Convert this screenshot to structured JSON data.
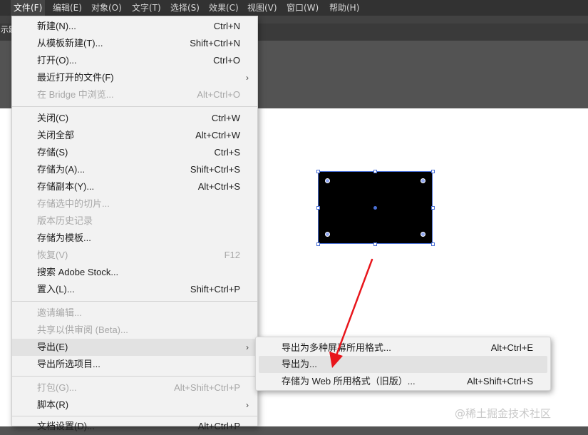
{
  "menubar": {
    "items": [
      "文件(F)",
      "编辑(E)",
      "对象(O)",
      "文字(T)",
      "选择(S)",
      "效果(C)",
      "视图(V)",
      "窗口(W)",
      "帮助(H)"
    ]
  },
  "tab": {
    "label": "示题"
  },
  "file_menu": {
    "items": [
      {
        "label": "新建(N)...",
        "shortcut": "Ctrl+N"
      },
      {
        "label": "从模板新建(T)...",
        "shortcut": "Shift+Ctrl+N"
      },
      {
        "label": "打开(O)...",
        "shortcut": "Ctrl+O"
      },
      {
        "label": "最近打开的文件(F)",
        "shortcut": ""
      },
      {
        "label": "在 Bridge 中浏览...",
        "shortcut": "Alt+Ctrl+O"
      },
      {
        "label": "关闭(C)",
        "shortcut": "Ctrl+W"
      },
      {
        "label": "关闭全部",
        "shortcut": "Alt+Ctrl+W"
      },
      {
        "label": "存储(S)",
        "shortcut": "Ctrl+S"
      },
      {
        "label": "存储为(A)...",
        "shortcut": "Shift+Ctrl+S"
      },
      {
        "label": "存储副本(Y)...",
        "shortcut": "Alt+Ctrl+S"
      },
      {
        "label": "存储选中的切片...",
        "shortcut": ""
      },
      {
        "label": "版本历史记录",
        "shortcut": ""
      },
      {
        "label": "存储为模板...",
        "shortcut": ""
      },
      {
        "label": "恢复(V)",
        "shortcut": "F12"
      },
      {
        "label": "搜索 Adobe Stock...",
        "shortcut": ""
      },
      {
        "label": "置入(L)...",
        "shortcut": "Shift+Ctrl+P"
      },
      {
        "label": "邀请编辑...",
        "shortcut": ""
      },
      {
        "label": "共享以供审阅 (Beta)...",
        "shortcut": ""
      },
      {
        "label": "导出(E)",
        "shortcut": ""
      },
      {
        "label": "导出所选项目...",
        "shortcut": ""
      },
      {
        "label": "打包(G)...",
        "shortcut": "Alt+Shift+Ctrl+P"
      },
      {
        "label": "脚本(R)",
        "shortcut": ""
      },
      {
        "label": "文档设置(D)...",
        "shortcut": "Alt+Ctrl+P"
      }
    ]
  },
  "export_menu": {
    "items": [
      {
        "label": "导出为多种屏幕所用格式...",
        "shortcut": "Alt+Ctrl+E"
      },
      {
        "label": "导出为...",
        "shortcut": ""
      },
      {
        "label": "存储为 Web 所用格式（旧版）...",
        "shortcut": "Alt+Shift+Ctrl+S"
      }
    ]
  },
  "submenu_arrow": "›",
  "watermark": "@稀土掘金技术社区",
  "colors": {
    "menubar_bg": "#323232",
    "menu_bg": "#f2f2f2",
    "selection": "#4a6fd4",
    "annotation_arrow": "#e8151b"
  }
}
